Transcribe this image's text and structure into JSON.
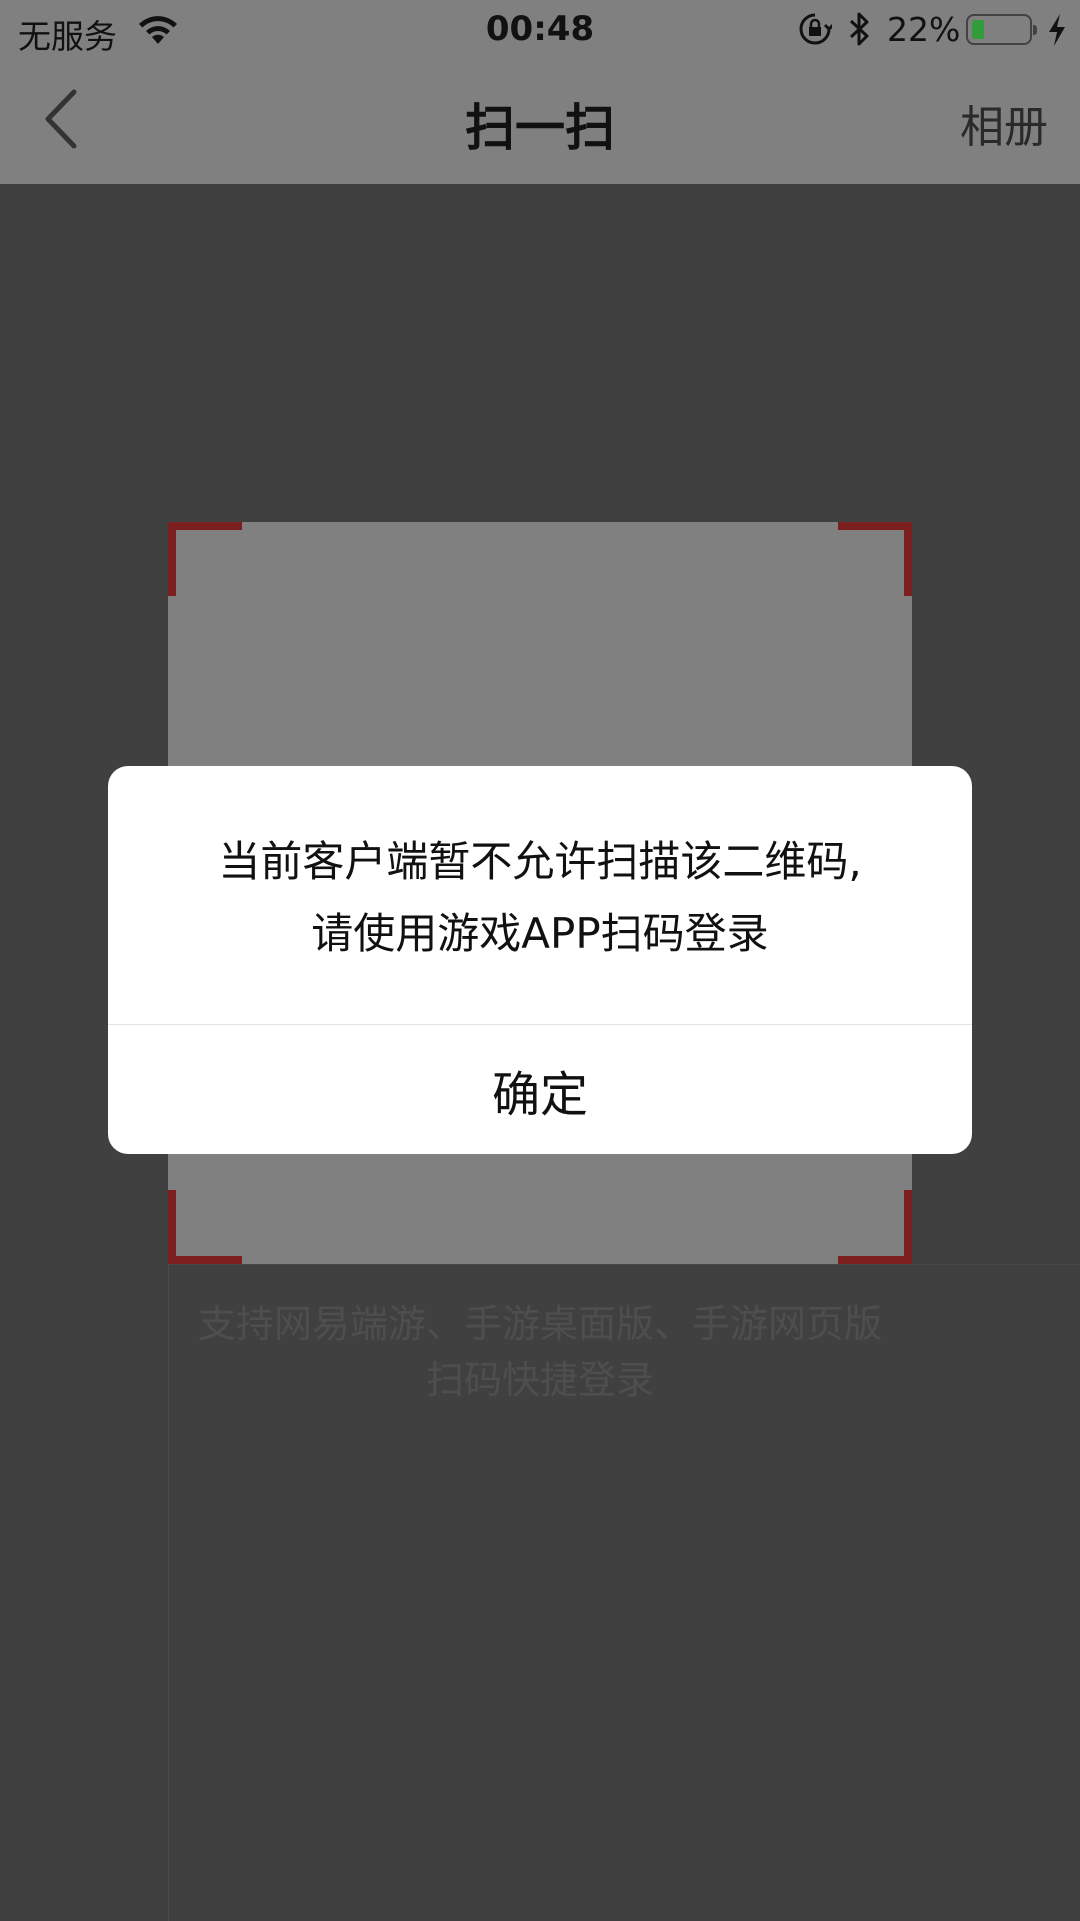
{
  "status_bar": {
    "carrier": "无服务",
    "time": "00:48",
    "battery_percent": "22%",
    "battery_level": 0.22,
    "icons": [
      "wifi-icon",
      "rotation-lock-icon",
      "bluetooth-icon",
      "battery-icon",
      "charging-icon"
    ]
  },
  "nav": {
    "title": "扫一扫",
    "album_label": "相册",
    "back_icon": "chevron-left-icon"
  },
  "scanner": {
    "hint_line1": "支持网易端游、手游桌面版、手游网页版",
    "hint_line2": "扫码快捷登录",
    "corner_color": "#7b1f1f"
  },
  "dialog": {
    "message_line1": "当前客户端暂不允许扫描该二维码,",
    "message_line2": "请使用游戏APP扫码登录",
    "confirm_label": "确定"
  }
}
